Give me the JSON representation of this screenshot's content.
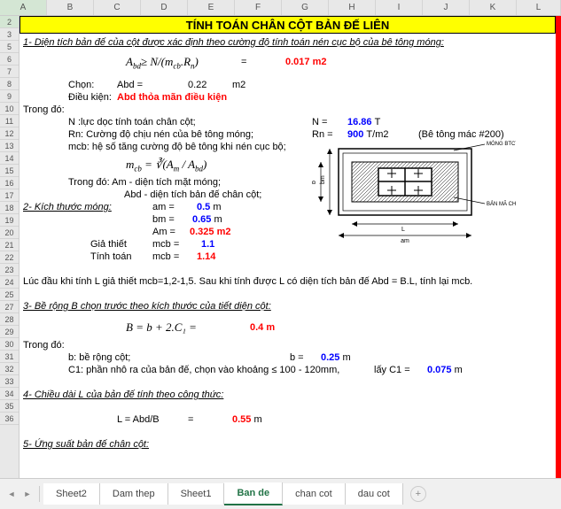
{
  "cols": [
    "A",
    "B",
    "C",
    "D",
    "E",
    "F",
    "G",
    "H",
    "I",
    "J",
    "K",
    "L"
  ],
  "rows": [
    "2",
    "3",
    "5",
    "6",
    "7",
    "8",
    "9",
    "10",
    "11",
    "12",
    "13",
    "14",
    "15",
    "16",
    "17",
    "18",
    "19",
    "20",
    "21",
    "22",
    "23",
    "24",
    "25",
    "27",
    "28",
    "29",
    "30",
    "31",
    "32",
    "33",
    "34",
    "35",
    "36"
  ],
  "title": "TÍNH TOÁN CHÂN CỘT BẢN ĐẾ LIÊN",
  "sec1": {
    "heading": "1- Diện tích bản đế của cột được xác định theo cường độ tính toán nén cục bộ của bê tông móng:",
    "formula_lhs": "A",
    "formula_sub": "bd",
    "formula_rhs1": "≥ N/(m",
    "formula_sub2": "cb",
    "formula_rhs2": ".R",
    "formula_sub3": "n",
    "formula_rhs3": ")",
    "eq": "=",
    "val": "0.017",
    "unit": "m2",
    "chon": "Chọn:",
    "abd": "Abd =",
    "abd_v": "0.22",
    "abd_u": "m2",
    "dk": "Điều kiện:",
    "dk_msg": "Abd thỏa mãn điều kiện",
    "trongdo": "Trong đó:",
    "n_label": "N :lực dọc tính toán chân cột;",
    "n_eq": "N =",
    "n_val": "16.86",
    "n_unit": "T",
    "rn_label": "Rn: Cường độ chịu nén của bê tông móng;",
    "rn_eq": "Rn =",
    "rn_val": "900",
    "rn_unit": "T/m2",
    "rn_note": "(Bê tông mác #200)",
    "mcb_label": "mcb: hệ số tăng cường độ bê tông khi nén cục bộ;",
    "mcb_formula_l": "m",
    "mcb_formula_sub": "cb",
    "mcb_formula_r": " = ∛(A",
    "mcb_formula_sub2": "m",
    "mcb_formula_r2": " / A",
    "mcb_formula_sub3": "bd",
    "mcb_formula_r3": ")",
    "am_desc": "Trong đó:   Am - diện tích mặt móng;",
    "abd_desc": "Abd - diện tích bản đế chân cột;"
  },
  "sec2": {
    "heading": "2- Kích thước móng:",
    "am_l": "am =",
    "am_v": "0.5",
    "am_u": "m",
    "bm_l": "bm =",
    "bm_v": "0.65",
    "bm_u": "m",
    "Am_l": "Am =",
    "Am_v": "0.325",
    "Am_u": "m2",
    "gt": "Giả thiết",
    "gt_l": "mcb =",
    "gt_v": "1.1",
    "tt": "Tính toán",
    "tt_l": "mcb =",
    "tt_v": "1.14",
    "note": "Lúc đầu khi tính L giả thiết mcb=1,2-1,5. Sau khi tính được L có diện tích bản đế Abd = B.L, tính lại mcb."
  },
  "sec3": {
    "heading": "3- Bề rộng B chọn trước theo kích thước của tiết diện cột:",
    "formula": "B = b + 2.C₁ =",
    "val": "0.4",
    "unit": "m",
    "trongdo": "Trong đó:",
    "b_label": "b: bề rộng cột;",
    "b_eq": "b =",
    "b_v": "0.25",
    "b_u": "m",
    "c1_label": "C1: phần nhô ra của bản đế, chọn vào khoảng ≤ 100 - 120mm,",
    "c1_eq": "lấy C1 =",
    "c1_v": "0.075",
    "c1_u": "m"
  },
  "sec4": {
    "heading": "4- Chiều dài L của bản đế tính theo công thức:",
    "formula": "L = Abd/B",
    "eq": "=",
    "val": "0.55",
    "unit": "m"
  },
  "sec5": {
    "heading": "5- Ứng suất bản đế chân cột:"
  },
  "diagram": {
    "label1": "MÓNG BTCT",
    "label2": "BẢN MÃ CHÂN CỘT",
    "dim1": "bm",
    "dim2": "b",
    "dim3": "L",
    "dim4": "am"
  },
  "tabs": {
    "items": [
      "Sheet2",
      "Dam thep",
      "Sheet1",
      "Ban de",
      "chan cot",
      "dau cot"
    ],
    "active": 3
  }
}
